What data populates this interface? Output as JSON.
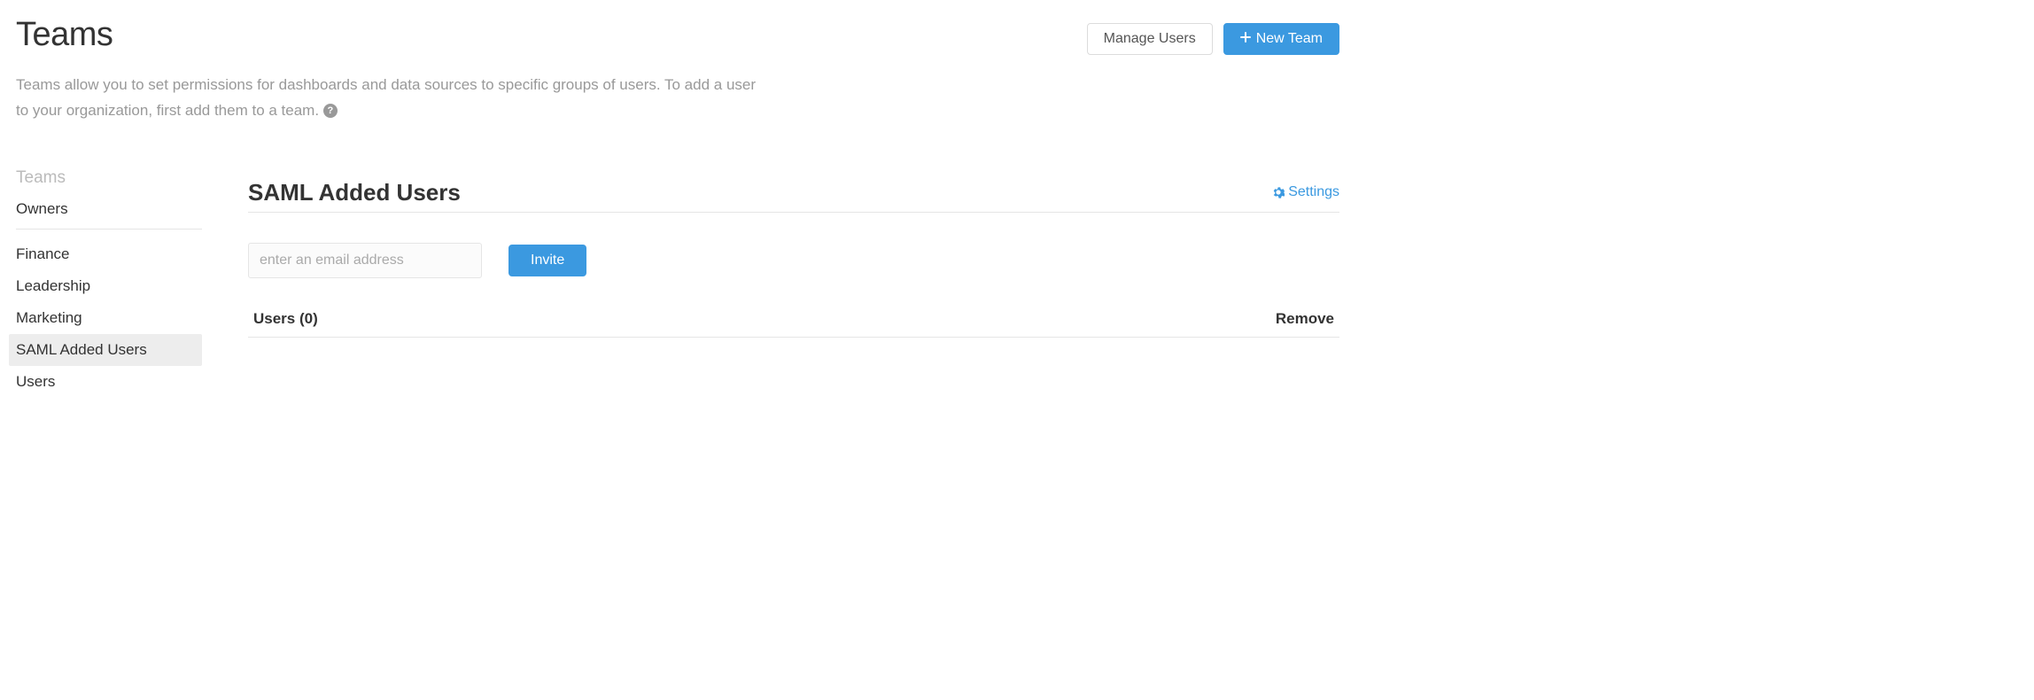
{
  "header": {
    "title": "Teams",
    "manage_users_label": "Manage Users",
    "new_team_label": "New Team"
  },
  "description": {
    "text": "Teams allow you to set permissions for dashboards and data sources to specific groups of users. To add a user to your organization, first add them to a team."
  },
  "sidebar": {
    "header": "Teams",
    "items": [
      {
        "label": "Owners",
        "owners": true,
        "selected": false
      },
      {
        "label": "Finance",
        "owners": false,
        "selected": false
      },
      {
        "label": "Leadership",
        "owners": false,
        "selected": false
      },
      {
        "label": "Marketing",
        "owners": false,
        "selected": false
      },
      {
        "label": "SAML Added Users",
        "owners": false,
        "selected": true
      },
      {
        "label": "Users",
        "owners": false,
        "selected": false
      }
    ]
  },
  "main": {
    "title": "SAML Added Users",
    "settings_label": "Settings",
    "email_placeholder": "enter an email address",
    "invite_label": "Invite",
    "users_header": "Users (0)",
    "remove_header": "Remove"
  }
}
